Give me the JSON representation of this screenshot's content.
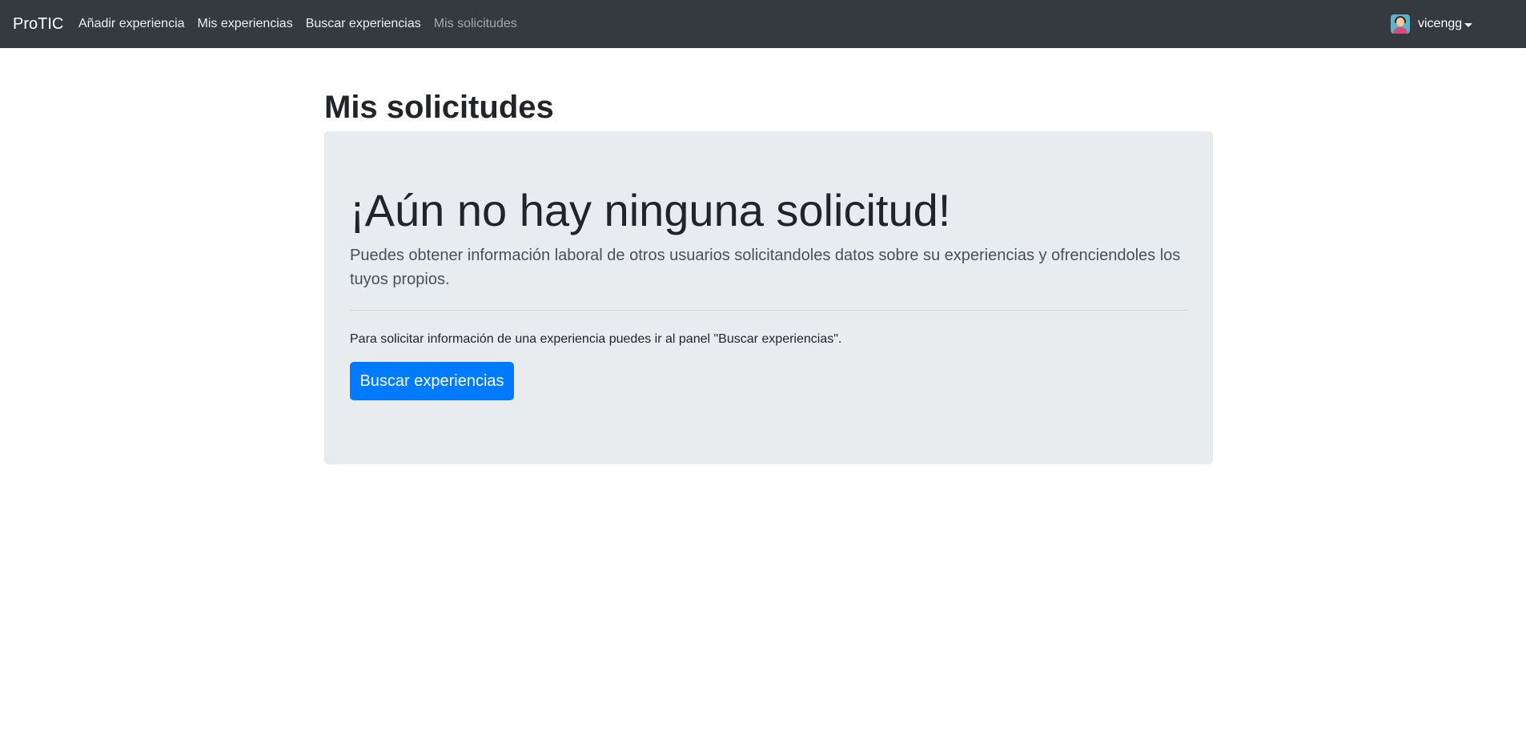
{
  "navbar": {
    "brand": "ProTIC",
    "links": [
      {
        "label": "Añadir experiencia"
      },
      {
        "label": "Mis experiencias"
      },
      {
        "label": "Buscar experiencias"
      },
      {
        "label": "Mis solicitudes",
        "active": true
      }
    ],
    "user": {
      "name": "vicengg",
      "avatar_icon": "user-avatar-icon"
    }
  },
  "main": {
    "title": "Mis solicitudes",
    "jumbotron": {
      "heading": "¡Aún no hay ninguna solicitud!",
      "lead": "Puedes obtener información laboral de otros usuarios solicitandoles datos sobre su experiencias y ofrenciendoles los tuyos propios.",
      "info": "Para solicitar información de una experiencia puedes ir al panel \"Buscar experiencias\".",
      "button_label": "Buscar experiencias"
    }
  },
  "colors": {
    "navbar_bg": "#343a40",
    "jumbotron_bg": "#e9ecef",
    "primary": "#007bff"
  }
}
